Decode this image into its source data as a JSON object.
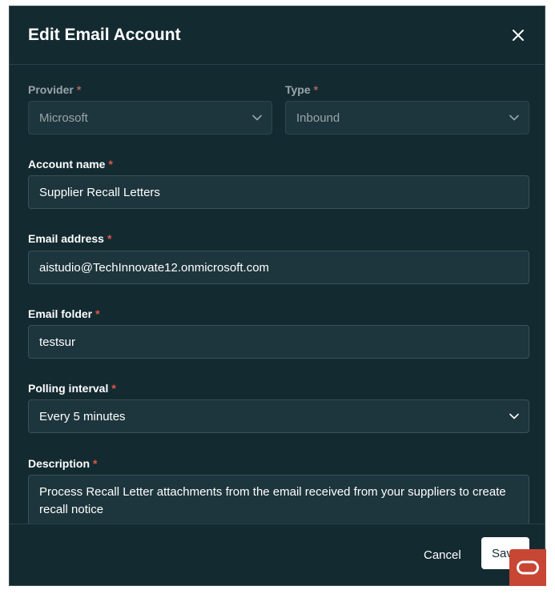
{
  "dialog": {
    "title": "Edit Email Account",
    "close_icon": "close-icon"
  },
  "form": {
    "provider": {
      "label": "Provider",
      "required_mark": "*",
      "value": "Microsoft"
    },
    "type": {
      "label": "Type",
      "required_mark": "*",
      "value": "Inbound"
    },
    "account_name": {
      "label": "Account name",
      "required_mark": "*",
      "value": "Supplier Recall Letters"
    },
    "email_address": {
      "label": "Email address",
      "required_mark": "*",
      "value": "aistudio@TechInnovate12.onmicrosoft.com"
    },
    "email_folder": {
      "label": "Email folder",
      "required_mark": "*",
      "value": "testsur"
    },
    "polling_interval": {
      "label": "Polling interval",
      "required_mark": "*",
      "value": "Every 5 minutes"
    },
    "description": {
      "label": "Description",
      "required_mark": "*",
      "value": "Process Recall Letter attachments from the email received from your suppliers to create recall notice"
    }
  },
  "footer": {
    "cancel_label": "Cancel",
    "save_label": "Save"
  },
  "badge": {
    "icon": "oracle-logo-icon"
  },
  "colors": {
    "background": "#132a31",
    "field": "#1d353c",
    "required": "#e0574b",
    "brand": "#c74634"
  }
}
